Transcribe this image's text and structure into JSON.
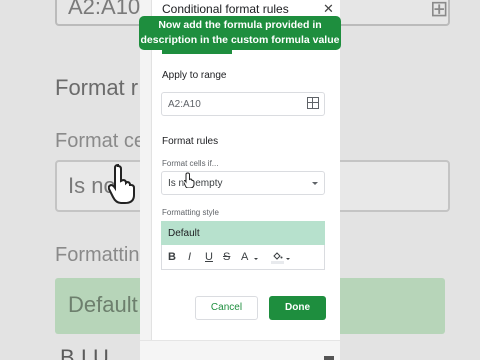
{
  "background": {
    "range_text": "A2:A10",
    "format_rules": "Format r",
    "format_cells": "Format cel",
    "condition_text": "Is no",
    "formatting_style": "Formatting",
    "default_text": "Default",
    "tools_text": "B I U"
  },
  "dialog": {
    "title": "Conditional format rules",
    "close_label": "✕",
    "annotation": "Now add the formula provided in description in the custom formula value",
    "apply_to_range_label": "Apply to range",
    "range_value": "A2:A10",
    "format_rules_label": "Format rules",
    "format_cells_if_label": "Format cells if...",
    "condition_value": "Is not empty",
    "formatting_style_label": "Formatting style",
    "style_preview": "Default",
    "toolbar": {
      "bold": "B",
      "italic": "I",
      "underline": "U",
      "strike": "S",
      "text_color": "A"
    },
    "cancel_label": "Cancel",
    "done_label": "Done"
  },
  "colors": {
    "accent": "#1e8e3e",
    "default_fill": "#b7e1cd"
  }
}
